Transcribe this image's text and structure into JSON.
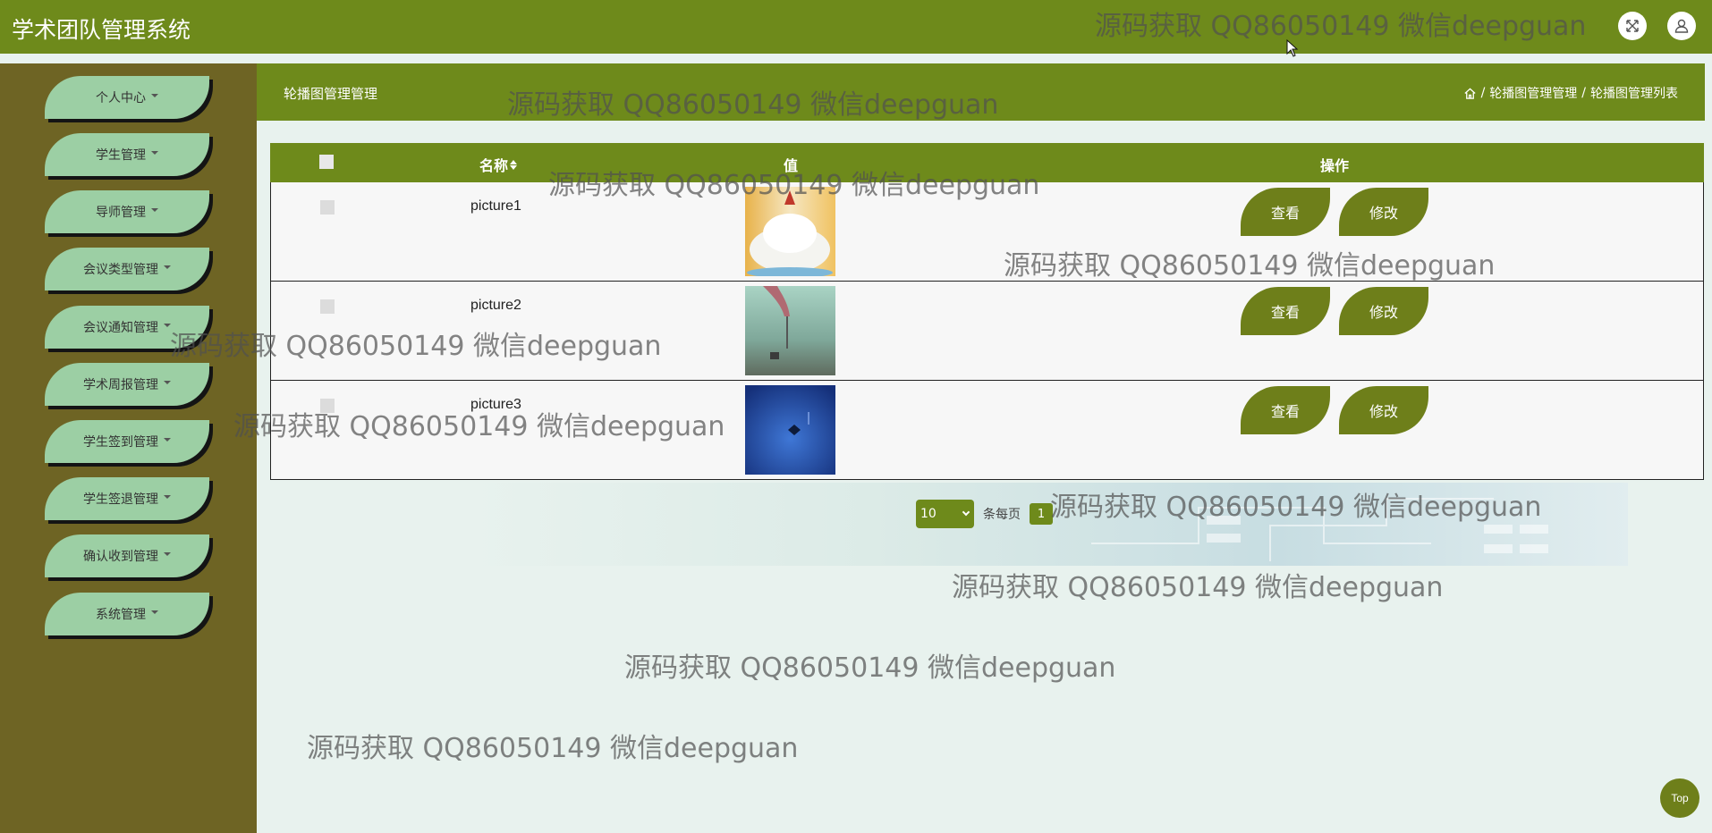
{
  "app": {
    "title": "学术团队管理系统"
  },
  "header_icons": [
    "fullscreen-icon",
    "user-icon"
  ],
  "sidebar": {
    "items": [
      {
        "label": "个人中心"
      },
      {
        "label": "学生管理"
      },
      {
        "label": "导师管理"
      },
      {
        "label": "会议类型管理"
      },
      {
        "label": "会议通知管理"
      },
      {
        "label": "学术周报管理"
      },
      {
        "label": "学生签到管理"
      },
      {
        "label": "学生签退管理"
      },
      {
        "label": "确认收到管理"
      },
      {
        "label": "系统管理"
      }
    ]
  },
  "page": {
    "title": "轮播图管理管理",
    "breadcrumb": [
      "轮播图管理管理",
      "轮播图管理列表"
    ]
  },
  "table": {
    "headers": {
      "name": "名称",
      "value": "值",
      "action": "操作"
    },
    "rows": [
      {
        "name": "picture1",
        "view": "查看",
        "edit": "修改"
      },
      {
        "name": "picture2",
        "view": "查看",
        "edit": "修改"
      },
      {
        "name": "picture3",
        "view": "查看",
        "edit": "修改"
      }
    ]
  },
  "pagination": {
    "page_size": "10",
    "per_page_label": "条每页",
    "current_page": "1"
  },
  "back_to_top": "Top",
  "watermark": "源码获取 QQ86050149 微信deepguan",
  "colors": {
    "primary": "#6e8a1b",
    "sidebar": "#6e6424",
    "menu_item": "#9ccfa4",
    "background": "#e8f2ee"
  }
}
